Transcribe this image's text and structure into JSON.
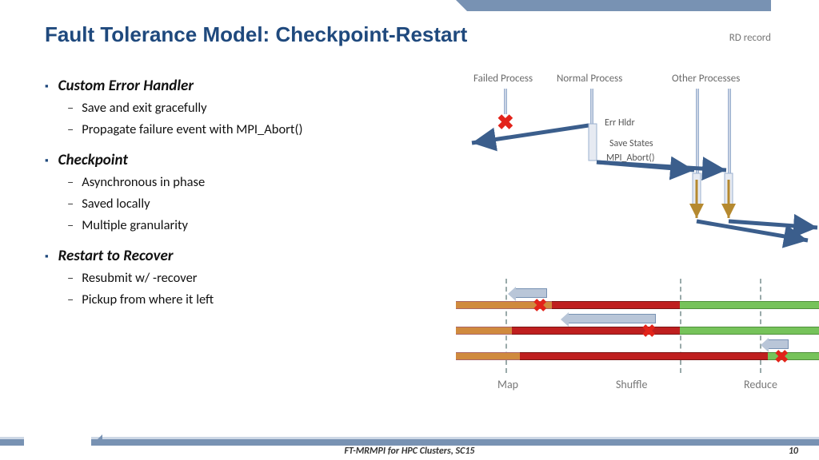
{
  "header": {
    "title": "Fault Tolerance Model: Checkpoint-Restart",
    "rd_record": "RD record"
  },
  "bullets": {
    "sec1": {
      "title": "Custom Error Handler",
      "items": [
        "Save and exit gracefully",
        "Propagate failure event with MPI_Abort()"
      ]
    },
    "sec2": {
      "title": "Checkpoint",
      "items": [
        "Asynchronous in phase",
        "Saved locally",
        "Multiple granularity"
      ]
    },
    "sec3": {
      "title": "Restart to Recover",
      "items": [
        "Resubmit w/ -recover",
        "Pickup from where it left"
      ]
    }
  },
  "diagram": {
    "failed": "Failed Process",
    "normal": "Normal Process",
    "other": "Other Processes",
    "err": "Err Hldr",
    "save": "Save States",
    "abort": "MPI_Abort()"
  },
  "phases": {
    "map": "Map",
    "shuffle": "Shuffle",
    "reduce": "Reduce"
  },
  "footer": {
    "text": "FT-MRMPI for HPC Clusters, SC15",
    "page": "10"
  }
}
